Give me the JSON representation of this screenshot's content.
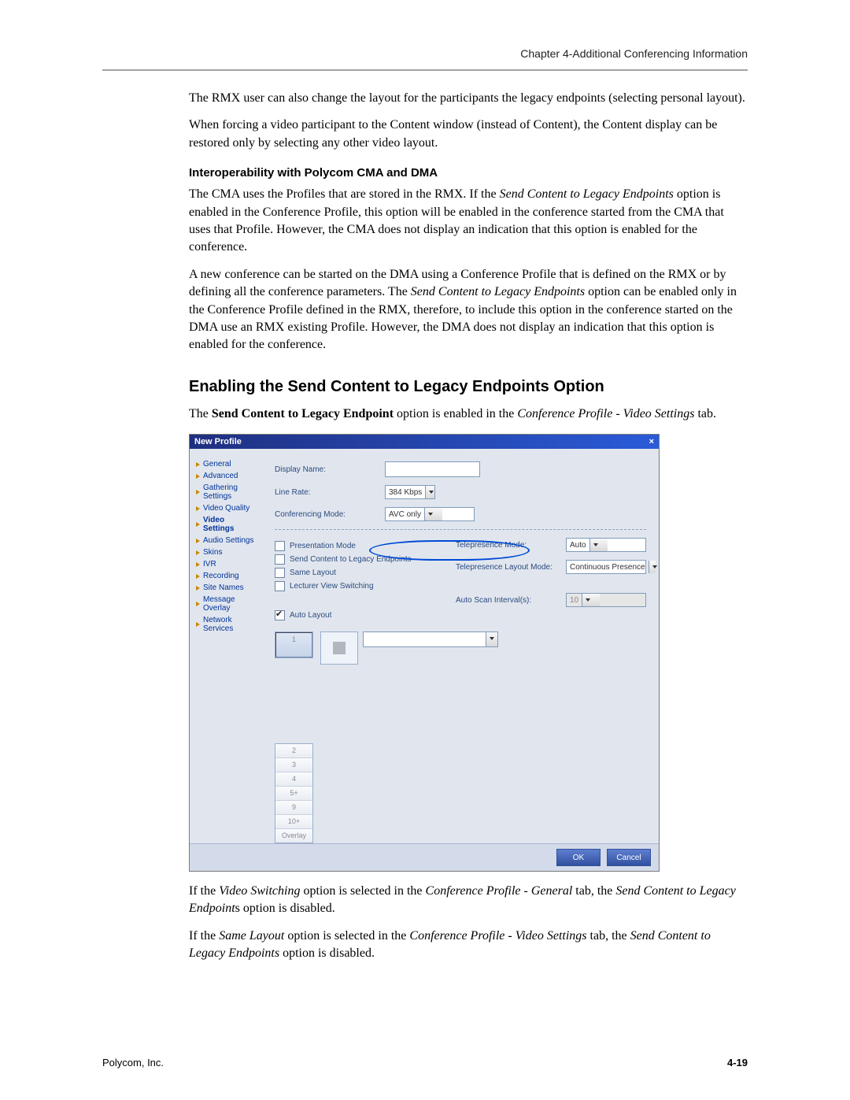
{
  "chapter": "Chapter 4-Additional Conferencing Information",
  "intro": {
    "p1": "The RMX user can also change the layout for the participants the legacy endpoints (selecting personal layout).",
    "p2": "When forcing a video participant to the Content window (instead of Content), the Content display can be restored only by selecting any other video layout."
  },
  "interop": {
    "heading": "Interoperability with Polycom CMA and DMA",
    "p1a": "The CMA uses the Profiles that are stored in the RMX. If the ",
    "p1b_italic": "Send Content to Legacy Endpoints",
    "p1c": " option is enabled in the Conference Profile, this option will be enabled in the conference started from the CMA that uses that Profile. However, the CMA does not display an indication that this option is enabled for the conference.",
    "p2a": "A new conference can be started on the DMA using a Conference Profile that is defined on the RMX or by defining all the conference parameters. The ",
    "p2b_italic": "Send Content to Legacy Endpoints",
    "p2c": " option can be enabled only in the Conference Profile defined in the RMX, therefore, to include this option in the conference started on the DMA use an RMX existing Profile. However, the DMA does not display an indication that this option is enabled for the conference."
  },
  "enabling": {
    "heading": "Enabling the Send Content to Legacy Endpoints Option",
    "p1a": "The ",
    "p1b_bold": "Send Content to Legacy Endpoint",
    "p1c": " option is enabled in the ",
    "p1d_italic": "Conference Profile - Video Settings",
    "p1e": " tab."
  },
  "dialog": {
    "title": "New Profile",
    "close": "×",
    "nav": [
      "General",
      "Advanced",
      "Gathering Settings",
      "Video Quality",
      "Video Settings",
      "Audio Settings",
      "Skins",
      "IVR",
      "Recording",
      "Site Names",
      "Message Overlay",
      "Network Services"
    ],
    "nav_active_index": 4,
    "labels": {
      "display_name": "Display Name:",
      "line_rate": "Line Rate:",
      "conferencing_mode": "Conferencing Mode:",
      "presentation_mode": "Presentation Mode",
      "send_content_legacy": "Send Content to Legacy Endpoints",
      "same_layout": "Same Layout",
      "lecturer_view": "Lecturer View Switching",
      "telepresence_mode": "Telepresence Mode:",
      "telepresence_layout_mode": "Telepresence Layout Mode:",
      "auto_scan": "Auto Scan Interval(s):",
      "auto_layout": "Auto Layout"
    },
    "values": {
      "display_name": "",
      "line_rate": "384 Kbps",
      "conferencing_mode": "AVC only",
      "telepresence_mode": "Auto",
      "telepresence_layout_mode": "Continuous Presence",
      "auto_scan": "10"
    },
    "layout_buttons_top": [
      "1"
    ],
    "layout_buttons_bottom": [
      "2",
      "3",
      "4",
      "5+",
      "9",
      "10+",
      "Overlay"
    ],
    "footer_ok": "OK",
    "footer_cancel": "Cancel"
  },
  "after": {
    "p1a": "If the ",
    "p1b_italic": "Video Switching",
    "p1c": " option is selected in the ",
    "p1d_italic": "Conference Profile - General",
    "p1e": " tab, the ",
    "p1f_italic": "Send Content to Legacy Endpoint",
    "p1g": "s option is disabled.",
    "p2a": "If the ",
    "p2b_italic": "Same Layout",
    "p2c": " option is selected in the ",
    "p2d_italic": "Conference Profile - Video Settings",
    "p2e": " tab, the ",
    "p2f_italic": "Send Content to Legacy Endpoints",
    "p2g": " option is disabled."
  },
  "footer": {
    "left": "Polycom, Inc.",
    "right": "4-19"
  }
}
